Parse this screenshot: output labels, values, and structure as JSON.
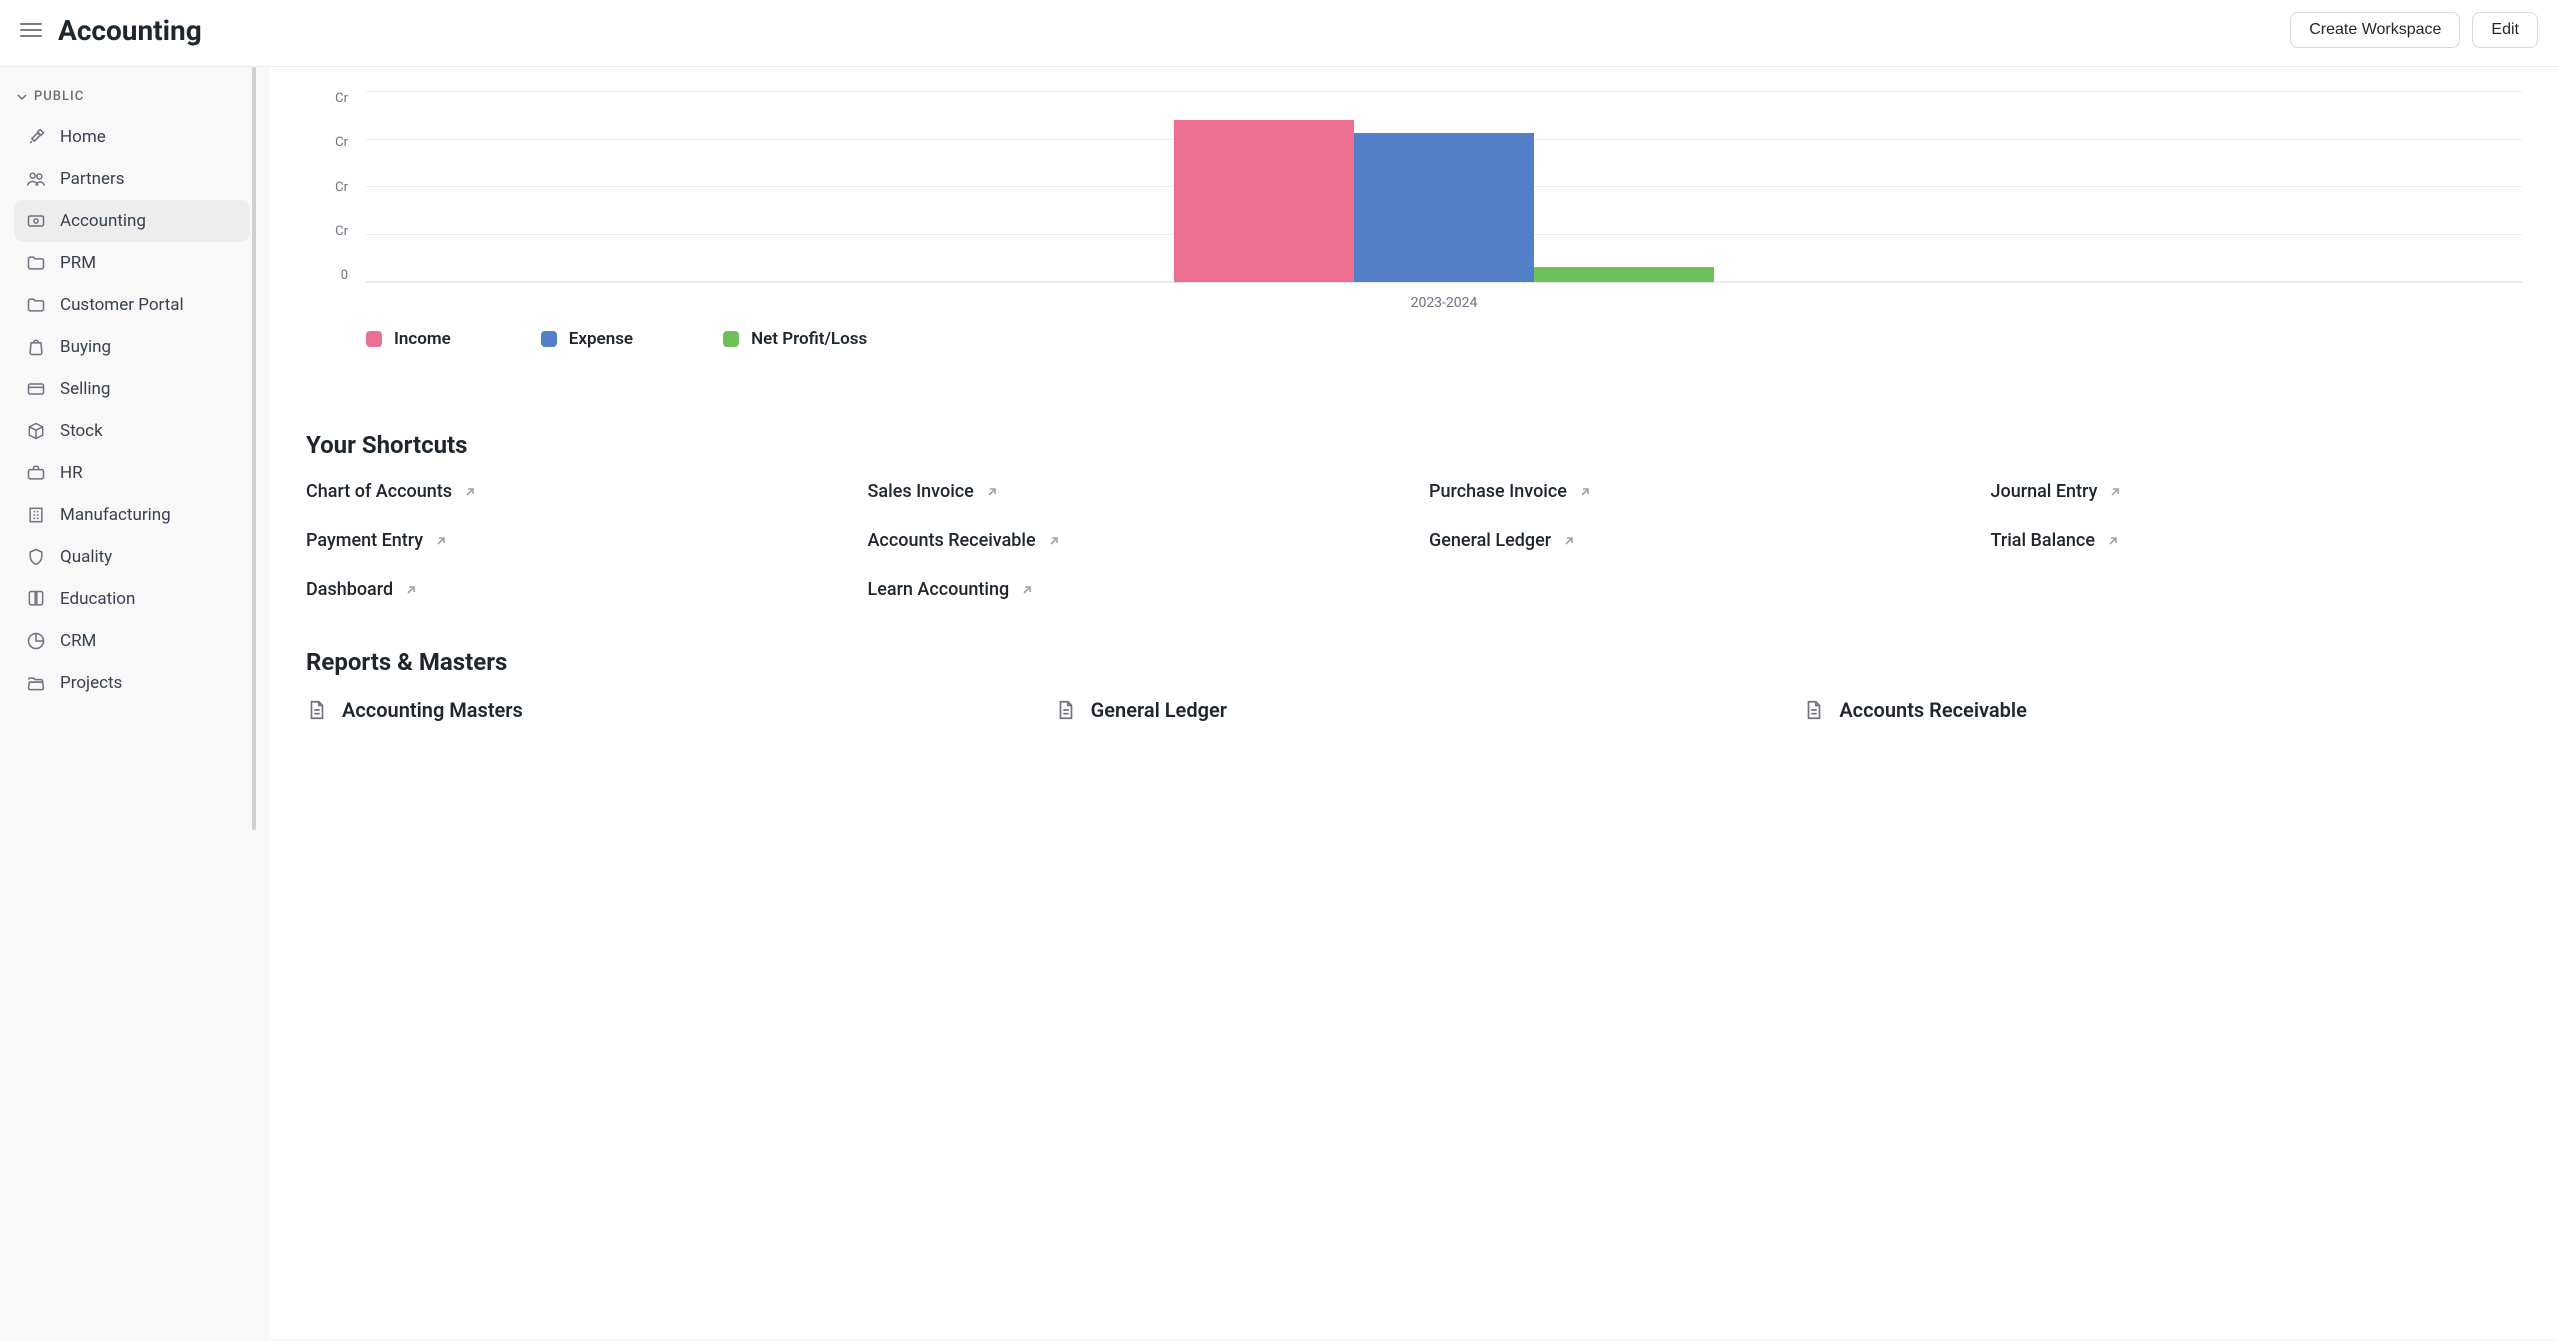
{
  "header": {
    "title": "Accounting",
    "create_workspace_label": "Create Workspace",
    "edit_label": "Edit"
  },
  "sidebar": {
    "section_label": "PUBLIC",
    "items": [
      {
        "label": "Home",
        "icon": "tools-icon",
        "active": false,
        "expandable": false
      },
      {
        "label": "Partners",
        "icon": "people-icon",
        "active": false,
        "expandable": false
      },
      {
        "label": "Accounting",
        "icon": "bill-icon",
        "active": true,
        "expandable": true
      },
      {
        "label": "PRM",
        "icon": "folder-icon",
        "active": false,
        "expandable": false
      },
      {
        "label": "Customer Portal",
        "icon": "folder-icon",
        "active": false,
        "expandable": false
      },
      {
        "label": "Buying",
        "icon": "bag-icon",
        "active": false,
        "expandable": false
      },
      {
        "label": "Selling",
        "icon": "card-icon",
        "active": false,
        "expandable": false
      },
      {
        "label": "Stock",
        "icon": "box-icon",
        "active": false,
        "expandable": false
      },
      {
        "label": "HR",
        "icon": "briefcase-icon",
        "active": false,
        "expandable": true
      },
      {
        "label": "Manufacturing",
        "icon": "building-icon",
        "active": false,
        "expandable": false
      },
      {
        "label": "Quality",
        "icon": "shield-icon",
        "active": false,
        "expandable": false
      },
      {
        "label": "Education",
        "icon": "book-icon",
        "active": false,
        "expandable": false
      },
      {
        "label": "CRM",
        "icon": "piechart-icon",
        "active": false,
        "expandable": false
      },
      {
        "label": "Projects",
        "icon": "folder-open-icon",
        "active": false,
        "expandable": false
      }
    ]
  },
  "chart_data": {
    "type": "bar",
    "title": "",
    "categories": [
      "2023-2024"
    ],
    "series": [
      {
        "name": "Income",
        "color": "#ec6e91",
        "values": [
          4.2
        ]
      },
      {
        "name": "Expense",
        "color": "#527fc7",
        "values": [
          3.9
        ]
      },
      {
        "name": "Net Profit/Loss",
        "color": "#6fbf5b",
        "values": [
          0.3
        ]
      }
    ],
    "y_tick_labels": [
      "Cr",
      "Cr",
      "Cr",
      "Cr",
      "0"
    ],
    "y_unit": "Cr",
    "ylim": [
      0,
      5
    ],
    "xlabel": "2023-2024",
    "legend": [
      "Income",
      "Expense",
      "Net Profit/Loss"
    ]
  },
  "shortcuts": {
    "title": "Your Shortcuts",
    "items": [
      "Chart of Accounts",
      "Sales Invoice",
      "Purchase Invoice",
      "Journal Entry",
      "Payment Entry",
      "Accounts Receivable",
      "General Ledger",
      "Trial Balance",
      "Dashboard",
      "Learn Accounting"
    ]
  },
  "reports": {
    "title": "Reports & Masters",
    "items": [
      "Accounting Masters",
      "General Ledger",
      "Accounts Receivable"
    ]
  }
}
